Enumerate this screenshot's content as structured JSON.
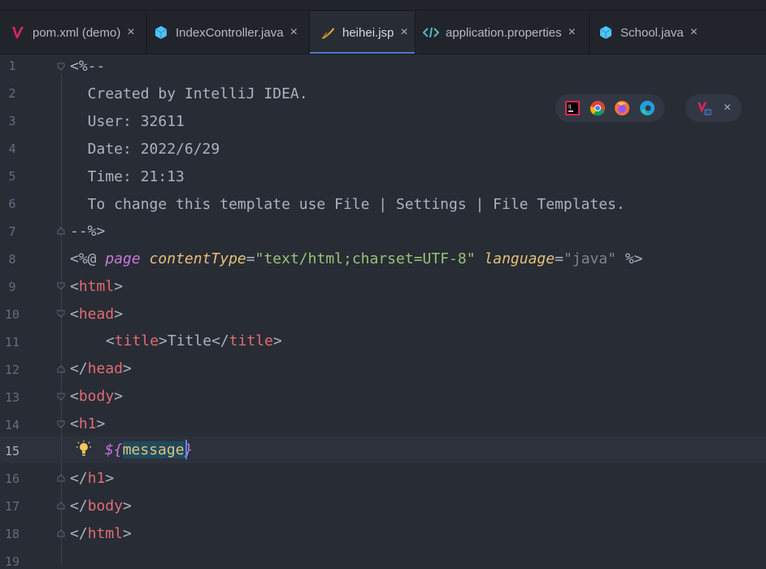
{
  "tabs": [
    {
      "label": "pom.xml (demo)",
      "icon": "maven-icon",
      "active": false
    },
    {
      "label": "IndexController.java",
      "icon": "java-class-icon",
      "active": false
    },
    {
      "label": "heihei.jsp",
      "icon": "jsp-icon",
      "active": true
    },
    {
      "label": "application.properties",
      "icon": "properties-icon",
      "active": false
    },
    {
      "label": "School.java",
      "icon": "java-class-icon",
      "active": false
    }
  ],
  "tab_close": "×",
  "line_numbers": [
    "1",
    "2",
    "3",
    "4",
    "5",
    "6",
    "7",
    "8",
    "9",
    "10",
    "11",
    "12",
    "13",
    "14",
    "15",
    "16",
    "17",
    "18",
    "19"
  ],
  "current_line": "15",
  "code": {
    "l1": "<%--",
    "l2": "  Created by IntelliJ IDEA.",
    "l3": "  User: 32611",
    "l4": "  Date: 2022/6/29",
    "l5": "  Time: 21:13",
    "l6": "  To change this template use File | Settings | File Templates.",
    "l7": "--%>",
    "l8": {
      "open": "<%@ ",
      "page": "page",
      "ct_attr": "contentType",
      "eq": "=",
      "ct_val": "\"text/html;charset=UTF-8\"",
      "lang_attr": "language",
      "lang_val": "\"java\"",
      "close": " %>"
    },
    "l9": {
      "lt": "<",
      "tag": "html",
      "gt": ">"
    },
    "l10": {
      "lt": "<",
      "tag": "head",
      "gt": ">"
    },
    "l11": {
      "lt": "<",
      "tag": "title",
      "gt": ">",
      "text": "Title",
      "lt2": "</",
      "tag2": "title",
      "gt2": ">"
    },
    "l12": {
      "lt": "</",
      "tag": "head",
      "gt": ">"
    },
    "l13": {
      "lt": "<",
      "tag": "body",
      "gt": ">"
    },
    "l14": {
      "lt": "<",
      "tag": "h1",
      "gt": ">"
    },
    "l15": {
      "open": "${",
      "var": "message",
      "close": "}"
    },
    "l16": {
      "lt": "</",
      "tag": "h1",
      "gt": ">"
    },
    "l17": {
      "lt": "</",
      "tag": "body",
      "gt": ">"
    },
    "l18": {
      "lt": "</",
      "tag": "html",
      "gt": ">"
    }
  },
  "browser_bar": {
    "icons": [
      "intellij-icon",
      "chrome-icon",
      "firefox-icon",
      "edge-icon"
    ]
  },
  "vue_bar": {
    "icon": "vue-devtools-icon",
    "close": "×"
  },
  "colors": {
    "background": "#282c34",
    "accent": "#4d78cc",
    "tag": "#e06c75",
    "string": "#98c379",
    "attr": "#e5c07b",
    "keyword": "#c678dd"
  }
}
